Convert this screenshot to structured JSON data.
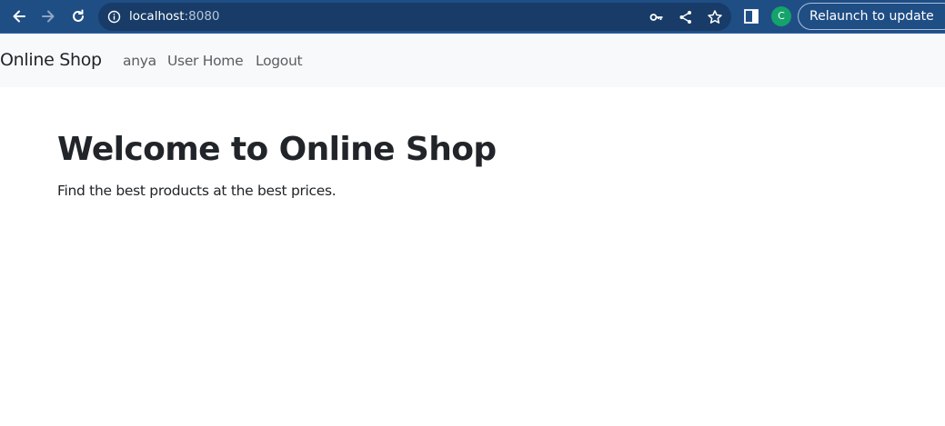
{
  "browser": {
    "url_host": "localhost",
    "url_port": ":8080",
    "profile_initial": "C",
    "relaunch_label": "Relaunch to update",
    "icons": {
      "back": "back-arrow-icon",
      "forward": "forward-arrow-icon",
      "reload": "reload-icon",
      "site_info": "info-icon",
      "password": "key-icon",
      "share": "share-icon",
      "bookmark": "star-icon",
      "side_panel": "side-panel-icon",
      "menu": "kebab-menu-icon"
    },
    "colors": {
      "toolbar": "#1f4e85",
      "omnibox": "#183c67",
      "avatar": "#15a36c"
    }
  },
  "navbar": {
    "brand": "Online Shop",
    "links": [
      "anya",
      "User Home",
      "Logout"
    ],
    "background": "#f8f9fa"
  },
  "main": {
    "title": "Welcome to Online Shop",
    "subtitle": "Find the best products at the best prices."
  }
}
